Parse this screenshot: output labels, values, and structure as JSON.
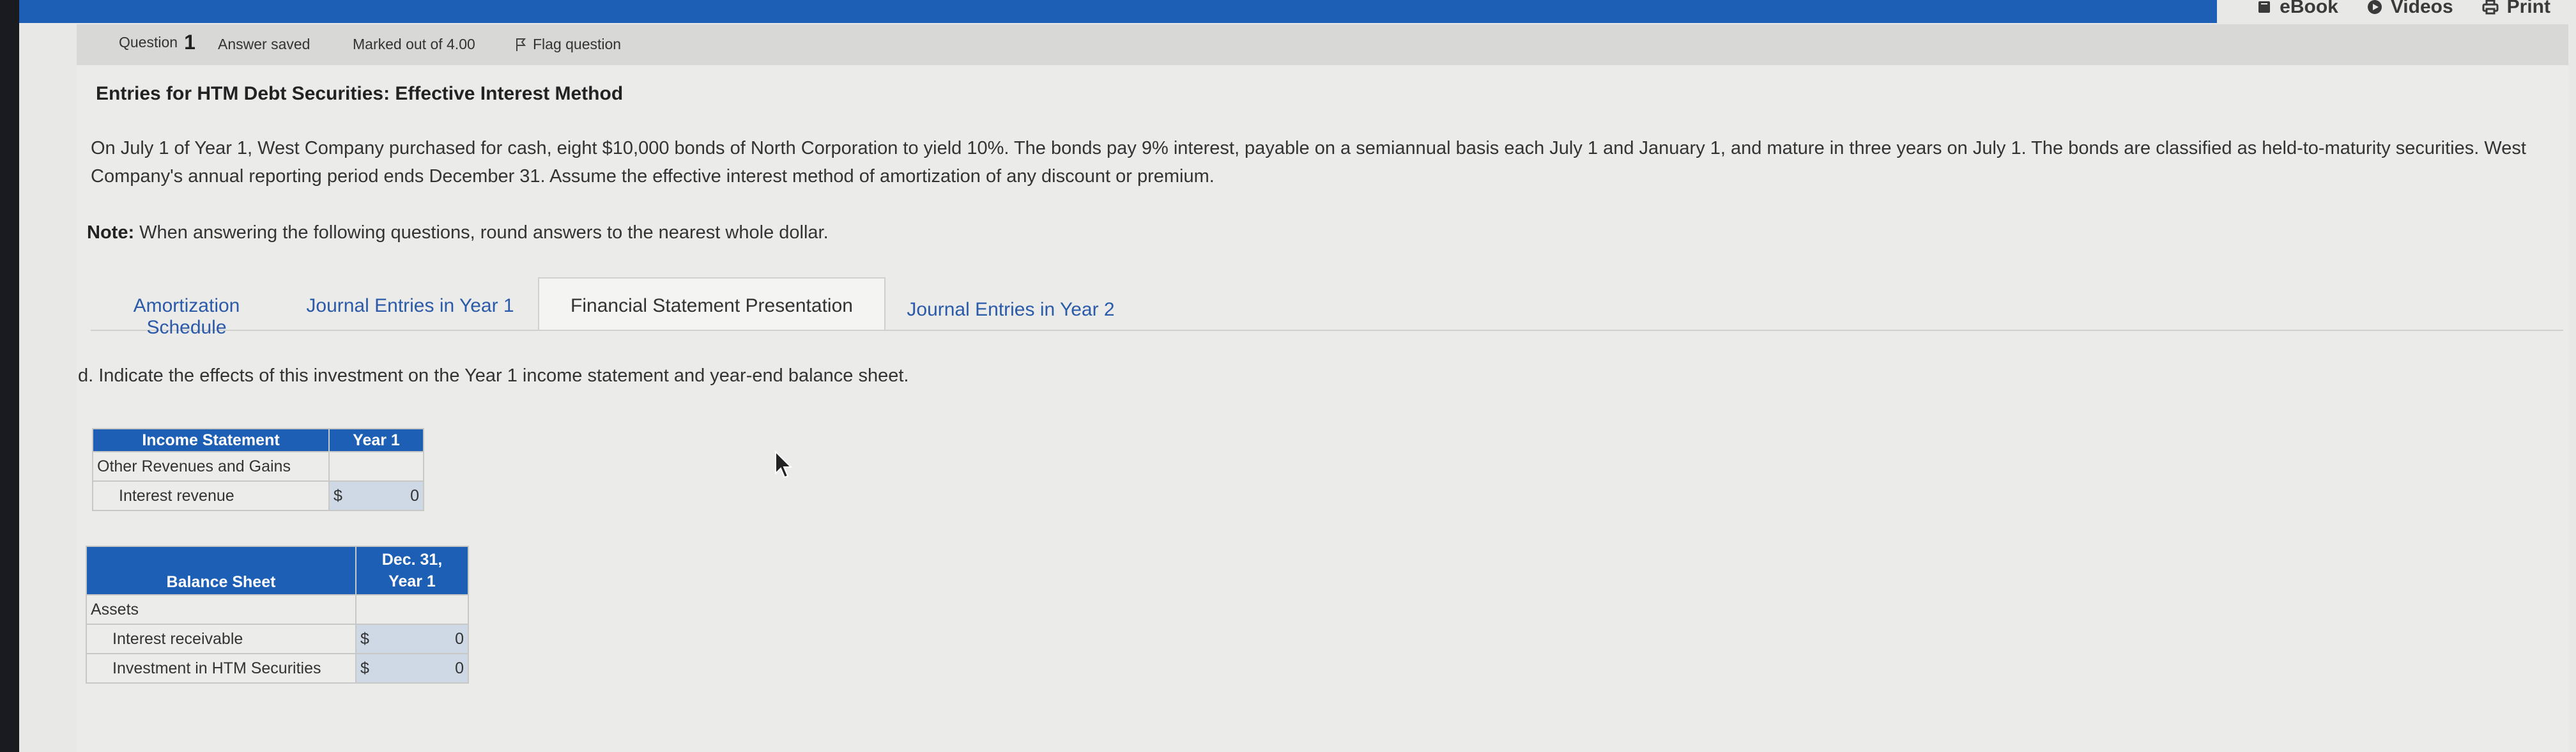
{
  "topbar": {
    "ebook_label": "eBook",
    "videos_label": "Videos",
    "print_label": "Print"
  },
  "question_header": {
    "question_label": "Question",
    "question_number": "1",
    "status": "Answer saved",
    "marked": "Marked out of 4.00",
    "flag_label": "Flag question"
  },
  "problem": {
    "title": "Entries for HTM Debt Securities: Effective Interest Method",
    "paragraph": "On July 1 of Year 1, West Company purchased for cash, eight $10,000 bonds of North Corporation to yield 10%. The bonds pay 9% interest, payable on a semiannual basis each July 1 and January 1, and mature in three years on July 1. The bonds are classified as held-to-maturity securities. West Company's annual reporting period ends December 31. Assume the effective interest method of amortization of any discount or premium.",
    "note_label": "Note:",
    "note_text": "When answering the following questions, round answers to the nearest whole dollar."
  },
  "tabs": [
    {
      "label": "Amortization Schedule",
      "active": false
    },
    {
      "label": "Journal Entries in Year 1",
      "active": false
    },
    {
      "label": "Financial Statement Presentation",
      "active": true
    },
    {
      "label": "Journal Entries in Year 2",
      "active": false
    }
  ],
  "question_text": "d. Indicate the effects of this investment on the Year 1 income statement and year-end balance sheet.",
  "income_statement": {
    "header": "Income Statement",
    "col": "Year 1",
    "section": "Other Revenues and Gains",
    "row_label": "Interest revenue",
    "currency": "$",
    "value": "0"
  },
  "balance_sheet": {
    "header": "Balance Sheet",
    "col_line1": "Dec. 31,",
    "col_line2": "Year 1",
    "section": "Assets",
    "rows": [
      {
        "label": "Interest receivable",
        "currency": "$",
        "value": "0"
      },
      {
        "label": "Investment in HTM Securities",
        "currency": "$",
        "value": "0"
      }
    ]
  },
  "colors": {
    "accent": "#1d5fb5",
    "input_fill": "#cfd9e6",
    "background": "#ebebea"
  }
}
